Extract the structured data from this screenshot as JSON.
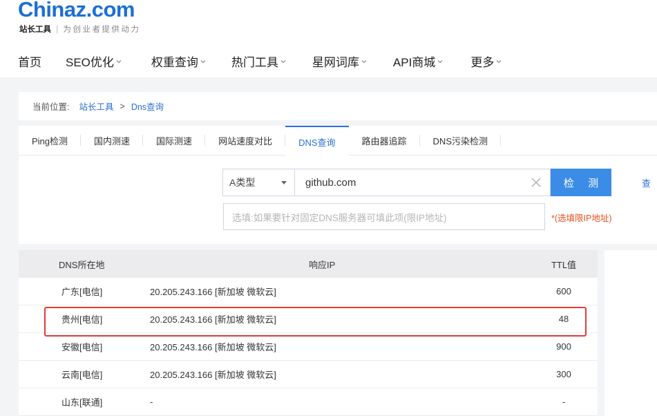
{
  "brand": {
    "logo_text": "Chinaz.com",
    "tagline_bold": "站长工具",
    "tagline_sep": "|",
    "tagline_rest": "为创业者提供动力"
  },
  "nav": {
    "items": [
      {
        "label": "首页",
        "has_dropdown": false
      },
      {
        "label": "SEO优化",
        "has_dropdown": true
      },
      {
        "label": "权重查询",
        "has_dropdown": true
      },
      {
        "label": "热门工具",
        "has_dropdown": true
      },
      {
        "label": "星网词库",
        "has_dropdown": true
      },
      {
        "label": "API商城",
        "has_dropdown": true
      },
      {
        "label": "更多",
        "has_dropdown": true
      }
    ]
  },
  "breadcrumb": {
    "prefix": "当前位置:",
    "home": "站长工具",
    "separator": ">",
    "current": "Dns查询"
  },
  "tabs": [
    {
      "label": "Ping检测",
      "active": false
    },
    {
      "label": "国内测速",
      "active": false
    },
    {
      "label": "国际测速",
      "active": false
    },
    {
      "label": "网站速度对比",
      "active": false
    },
    {
      "label": "DNS查询",
      "active": true
    },
    {
      "label": "路由器追踪",
      "active": false
    },
    {
      "label": "DNS污染检测",
      "active": false
    }
  ],
  "form": {
    "record_type": "A类型",
    "domain_value": "github.com",
    "detect_label": "检 测",
    "side_link": "查",
    "dns_server_placeholder": "选填:如果要针对固定DNS服务器可填此项(限IP地址)",
    "dns_server_note": "*(选填限IP地址)"
  },
  "table": {
    "headers": {
      "location": "DNS所在地",
      "ip": "响应IP",
      "ttl": "TTL值"
    },
    "rows": [
      {
        "location": "广东[电信]",
        "ip": "20.205.243.166 [新加坡 微软云]",
        "ttl": "600"
      },
      {
        "location": "贵州[电信]",
        "ip": "20.205.243.166 [新加坡 微软云]",
        "ttl": "48"
      },
      {
        "location": "安徽[电信]",
        "ip": "20.205.243.166 [新加坡 微软云]",
        "ttl": "900"
      },
      {
        "location": "云南[电信]",
        "ip": "20.205.243.166 [新加坡 微软云]",
        "ttl": "300"
      },
      {
        "location": "山东[联通]",
        "ip": "-",
        "ttl": "-"
      }
    ],
    "highlighted_row_index": 1
  },
  "colors": {
    "brand_blue": "#1b6fd3",
    "link_blue": "#2a6fd6",
    "button_blue": "#3b8ce7",
    "note_orange": "#e8501f",
    "highlight_red": "#e23a3a"
  }
}
